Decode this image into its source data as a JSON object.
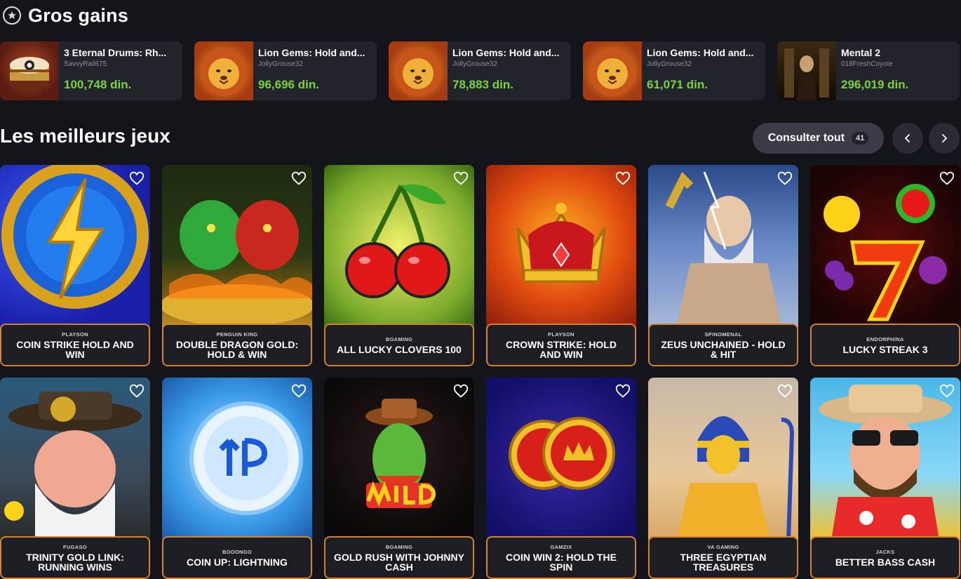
{
  "big_wins": {
    "title": "Gros gains",
    "items": [
      {
        "game": "3 Eternal Drums: Rh...",
        "user": "SavvyRail675",
        "amount": "100,748 din."
      },
      {
        "game": "Lion Gems: Hold and...",
        "user": "JollyGrouse32",
        "amount": "96,696 din."
      },
      {
        "game": "Lion Gems: Hold and...",
        "user": "JollyGrouse32",
        "amount": "78,883 din."
      },
      {
        "game": "Lion Gems: Hold and...",
        "user": "JollyGrouse32",
        "amount": "61,071 din."
      },
      {
        "game": "Mental 2",
        "user": "018FreshCoyote",
        "amount": "296,019 din."
      }
    ]
  },
  "top_games": {
    "title": "Les meilleurs jeux",
    "see_all_label": "Consulter tout",
    "see_all_count": "41",
    "games": [
      {
        "provider": "PLAYSON",
        "name": "COIN STRIKE HOLD AND WIN"
      },
      {
        "provider": "PENGUIN KING",
        "name": "DOUBLE DRAGON GOLD: HOLD & WIN"
      },
      {
        "provider": "BGAMING",
        "name": "ALL LUCKY CLOVERS 100"
      },
      {
        "provider": "PLAYSON",
        "name": "CROWN STRIKE: HOLD AND WIN"
      },
      {
        "provider": "SPINOMENAL",
        "name": "ZEUS UNCHAINED - HOLD & HIT"
      },
      {
        "provider": "ENDORPHINA",
        "name": "LUCKY STREAK 3"
      },
      {
        "provider": "FUGASO",
        "name": "TRINITY GOLD LINK: RUNNING WINS"
      },
      {
        "provider": "BOOONGO",
        "name": "COIN UP: LIGHTNING"
      },
      {
        "provider": "BGAMING",
        "name": "GOLD RUSH WITH JOHNNY CASH"
      },
      {
        "provider": "GAMZIX",
        "name": "COIN WIN 2: HOLD THE SPIN"
      },
      {
        "provider": "VA GAMING",
        "name": "THREE EGYPTIAN TREASURES"
      },
      {
        "provider": "JACKS",
        "name": "BETTER BASS CASH"
      }
    ]
  },
  "colors": {
    "background": "#14151a",
    "card": "#22242b",
    "win_amount": "#7bd33a",
    "label_border": "#d7822b"
  }
}
